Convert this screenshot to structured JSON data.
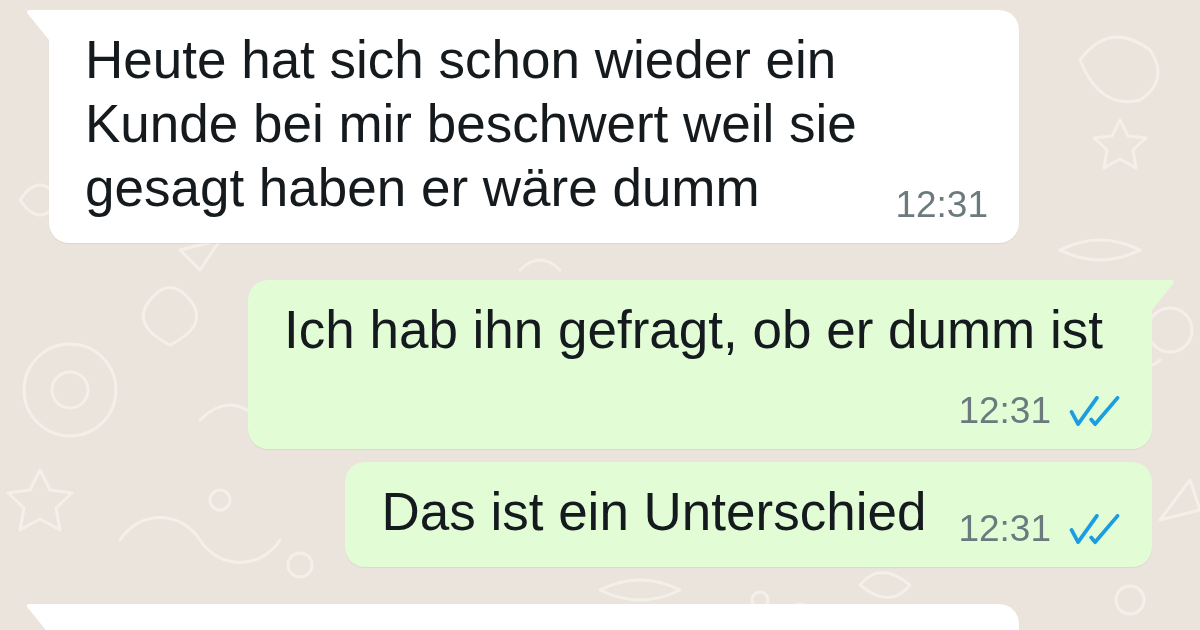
{
  "messages": [
    {
      "kind": "incoming",
      "text": "Heute hat sich schon wieder ein Kunde bei mir beschwert weil sie gesagt haben er wäre dumm",
      "time": "12:31"
    },
    {
      "kind": "outgoing",
      "text": "Ich hab ihn gefragt, ob er dumm ist",
      "time": "12:31",
      "read": true
    },
    {
      "kind": "outgoing",
      "text": "Das ist ein Unterschied",
      "time": "12:31",
      "read": true
    },
    {
      "kind": "incoming"
    }
  ]
}
